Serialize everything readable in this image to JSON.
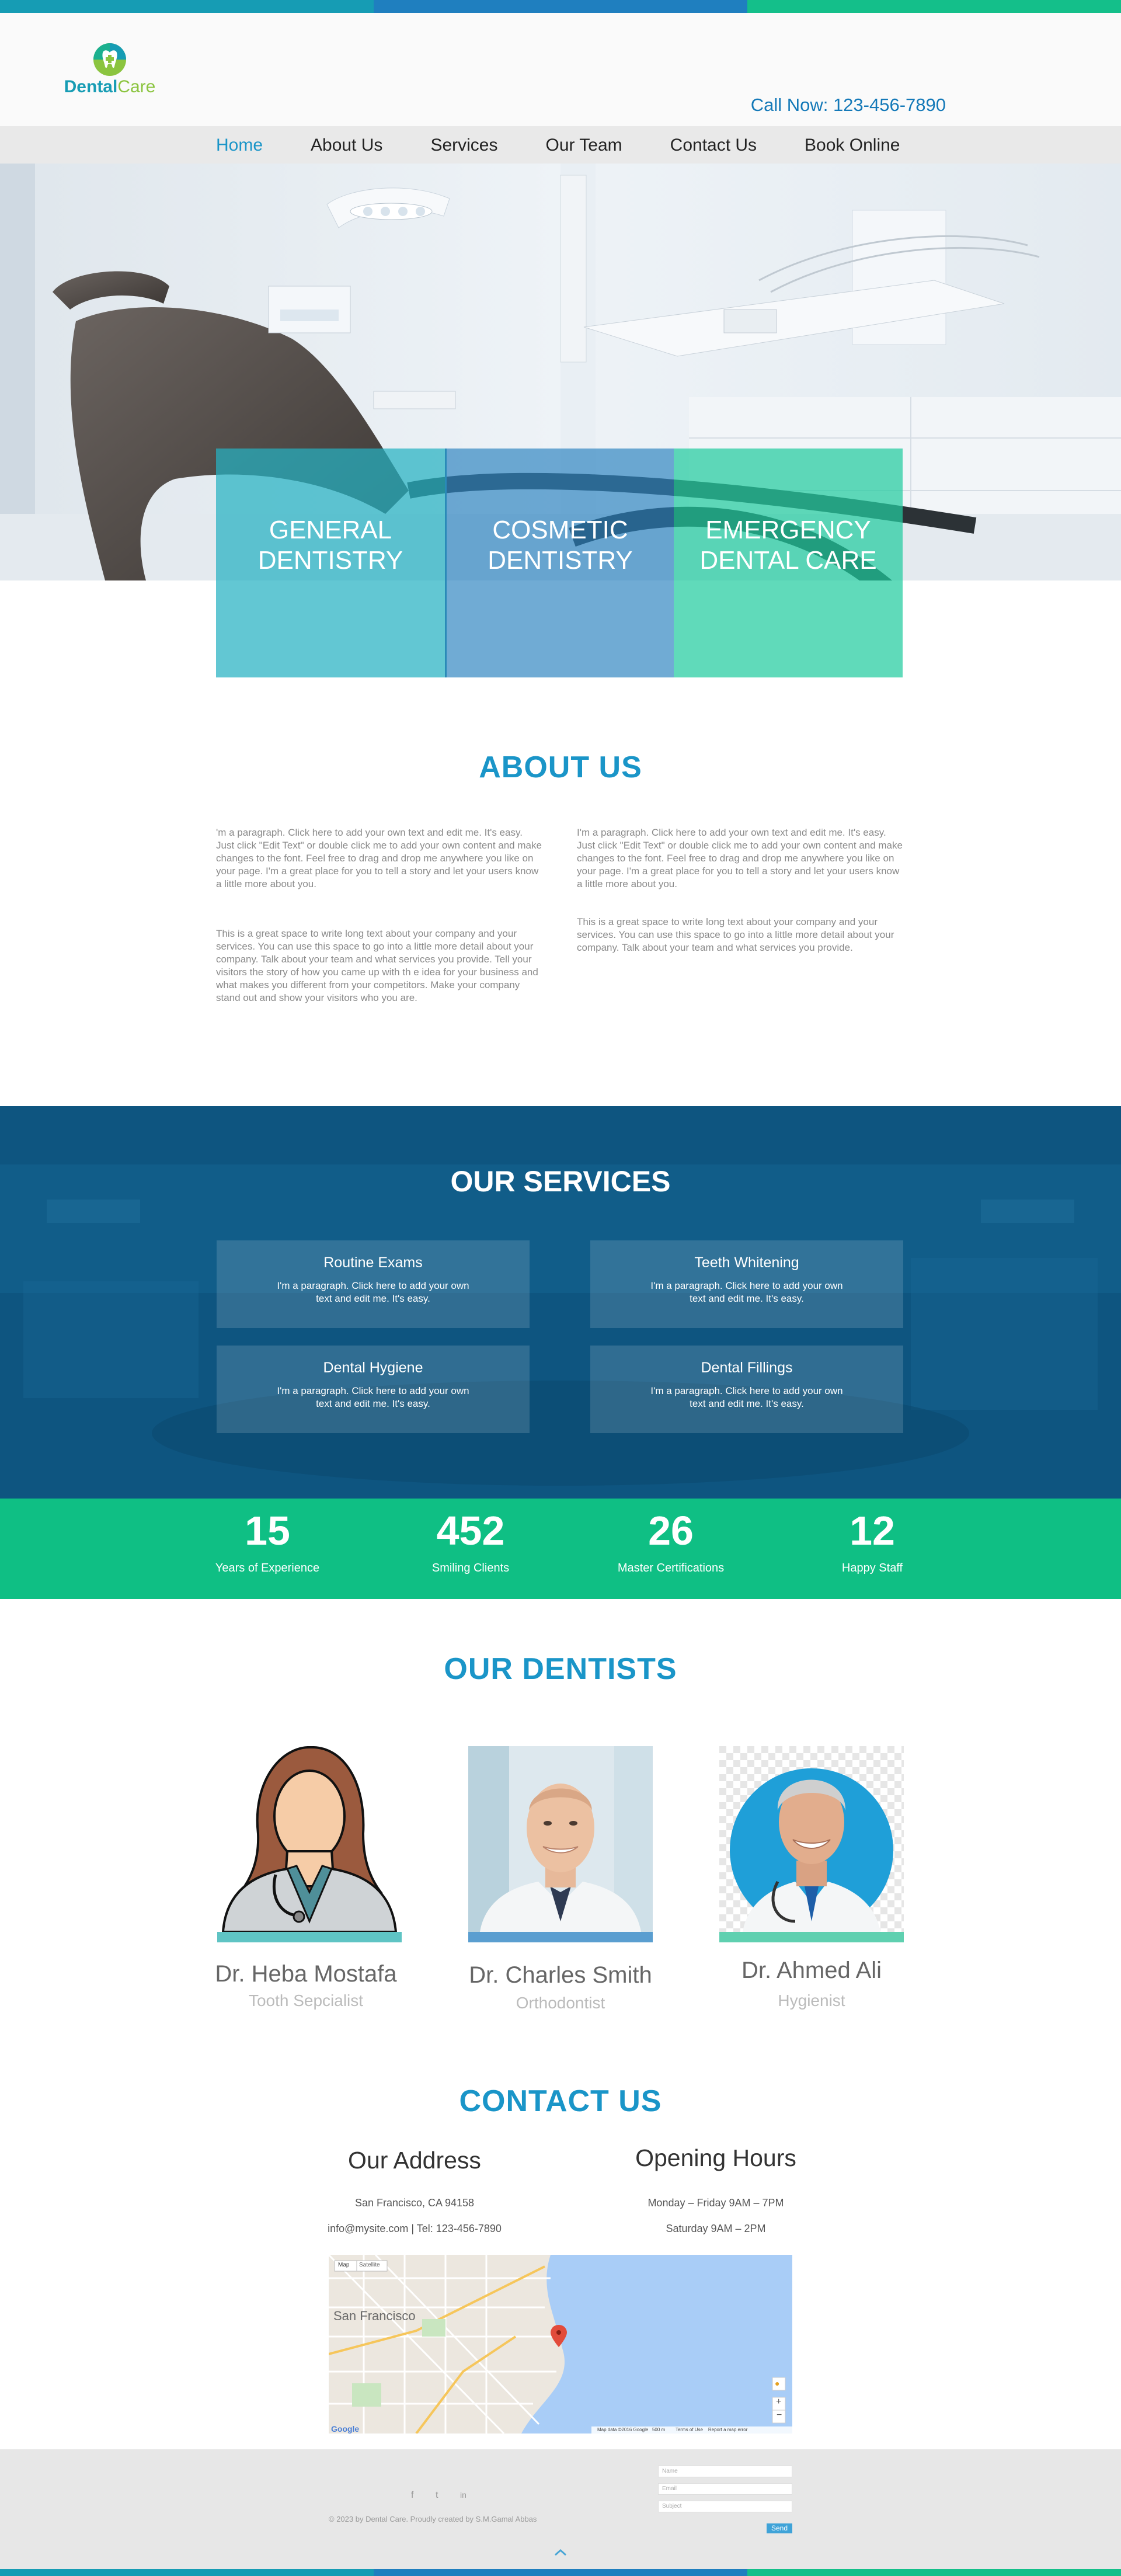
{
  "brand": {
    "name_part1": "Dental",
    "name_part2": "Care"
  },
  "header": {
    "call_now": "Call Now: 123-456-7890"
  },
  "nav": {
    "items": [
      "Home",
      "About Us",
      "Services",
      "Our Team",
      "Contact Us",
      "Book Online"
    ],
    "active": "Home"
  },
  "hero": {
    "boxes": [
      "GENERAL\nDENTISTRY",
      "COSMETIC\nDENTISTRY",
      "EMERGENCY\nDENTAL CARE"
    ]
  },
  "about": {
    "title": "ABOUT US",
    "left_p1": "'m a paragraph. Click here to add your own text and edit me. It's easy. Just click \"Edit Text\" or double click me to add your own content and make changes to the font. Feel free to drag and drop me anywhere you like on your page. I'm a great place for you to tell a story and let your users know a little more about you.",
    "left_p2": "This is a great space to write long text about your company and your services. You can use this space to go into a little more detail about your company. Talk about your team and what services you provide. Tell your visitors the story of how you came up with th e idea for your business and what makes you different from your competitors. Make your company stand out and show your visitors who you are.",
    "right_p1": "I'm a paragraph. Click here to add your own text and edit me. It's easy. Just click \"Edit Text\" or double click me to add your own content and make changes to the font. Feel free to drag and drop me anywhere you like on your page. I'm a great place for you to tell a story and let your users know a little more about you.",
    "right_p2": "This is a great space to write long text about your company and your services. You can use this space to go into a little more detail about your company. Talk about your team and what services you provide."
  },
  "services": {
    "title": "OUR SERVICES",
    "cards": [
      {
        "title": "Routine Exams",
        "text": "I'm a paragraph. Click here to add your own text and edit me. It's easy."
      },
      {
        "title": "Teeth Whitening",
        "text": "I'm a paragraph. Click here to add your own text and edit me. It's easy."
      },
      {
        "title": "Dental Hygiene",
        "text": "I'm a paragraph. Click here to add your own text and edit me. It's easy."
      },
      {
        "title": "Dental Fillings",
        "text": "I'm a paragraph. Click here to add your own text and edit me. It's easy."
      }
    ]
  },
  "stats": [
    {
      "value": "15",
      "label": "Years of Experience"
    },
    {
      "value": "452",
      "label": "Smiling  Clients"
    },
    {
      "value": "26",
      "label": "Master Certifications"
    },
    {
      "value": "12",
      "label": "Happy Staff"
    }
  ],
  "dentists": {
    "title": "OUR DENTISTS",
    "people": [
      {
        "name": "Dr. Heba Mostafa",
        "role": "Tooth Sepcialist"
      },
      {
        "name": "Dr. Charles Smith",
        "role": "Orthodontist"
      },
      {
        "name": "Dr. Ahmed Ali",
        "role": "Hygienist"
      }
    ]
  },
  "contact": {
    "title": "CONTACT US",
    "address_heading": "Our Address",
    "address_line1": "San Francisco, CA 94158",
    "address_line2": "info@mysite.com | Tel: 123-456-7890",
    "hours_heading": "Opening Hours",
    "hours_line1": "Monday – Friday  9AM – 7PM",
    "hours_line2": "Saturday    9AM – 2PM"
  },
  "map": {
    "tab_map": "Map",
    "tab_satellite": "Satellite",
    "city": "San Francisco",
    "footer_text": "Map data ©2016 Google   500 m        Terms of Use    Report a map error",
    "google": "Google"
  },
  "footer": {
    "copyright": "© 2023 by Dental Care. Proudly created by S.M.Gamal Abbas",
    "social": [
      "f",
      "t",
      "in"
    ],
    "form": {
      "name_placeholder": "Name",
      "email_placeholder": "Email",
      "subject_placeholder": "Subject",
      "send": "Send"
    }
  },
  "colors": {
    "primary": "#1a95c8",
    "services_bg": "#0e5580",
    "stats_bg": "#0fbf84",
    "teal": "#169cb4",
    "green": "#8bc43f"
  }
}
